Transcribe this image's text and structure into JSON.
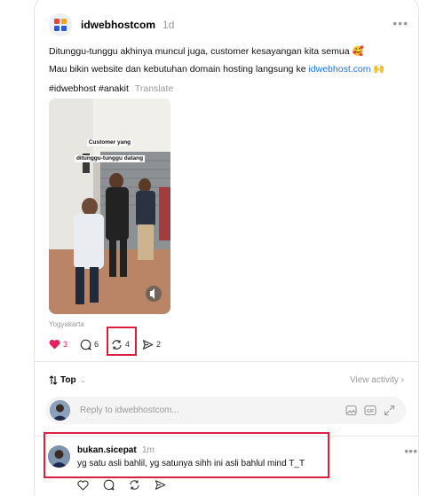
{
  "post": {
    "username": "idwebhostcom",
    "time": "1d",
    "line1": "Ditunggu-tunggu akhinya muncul juga, customer kesayangan kita semua 🥰",
    "line2_prefix": "Mau bikin website dan kebutuhan domain hosting langsung ke ",
    "line2_link": "idwebhost.com",
    "line2_suffix": " 🙌",
    "hashtags": "#idwebhost #anakit",
    "translate": "Translate",
    "media_caption_line1": "Customer yang",
    "media_caption_line2": "ditunggu-tunggu datang",
    "location": "Yogyakarta",
    "likes": "3",
    "comments": "6",
    "reposts": "4",
    "shares": "2"
  },
  "sort": {
    "label": "Top",
    "view_activity": "View activity"
  },
  "reply": {
    "placeholder": "Reply to idwebhostcom..."
  },
  "comment": {
    "username": "bukan.sicepat",
    "time": "1m",
    "text": "yg satu asli bahlil, yg satunya sihh ini asli bahlul mind T_T"
  },
  "colors": {
    "like": "#e0245e",
    "link": "#1a73e8",
    "highlight": "#d9213d"
  }
}
